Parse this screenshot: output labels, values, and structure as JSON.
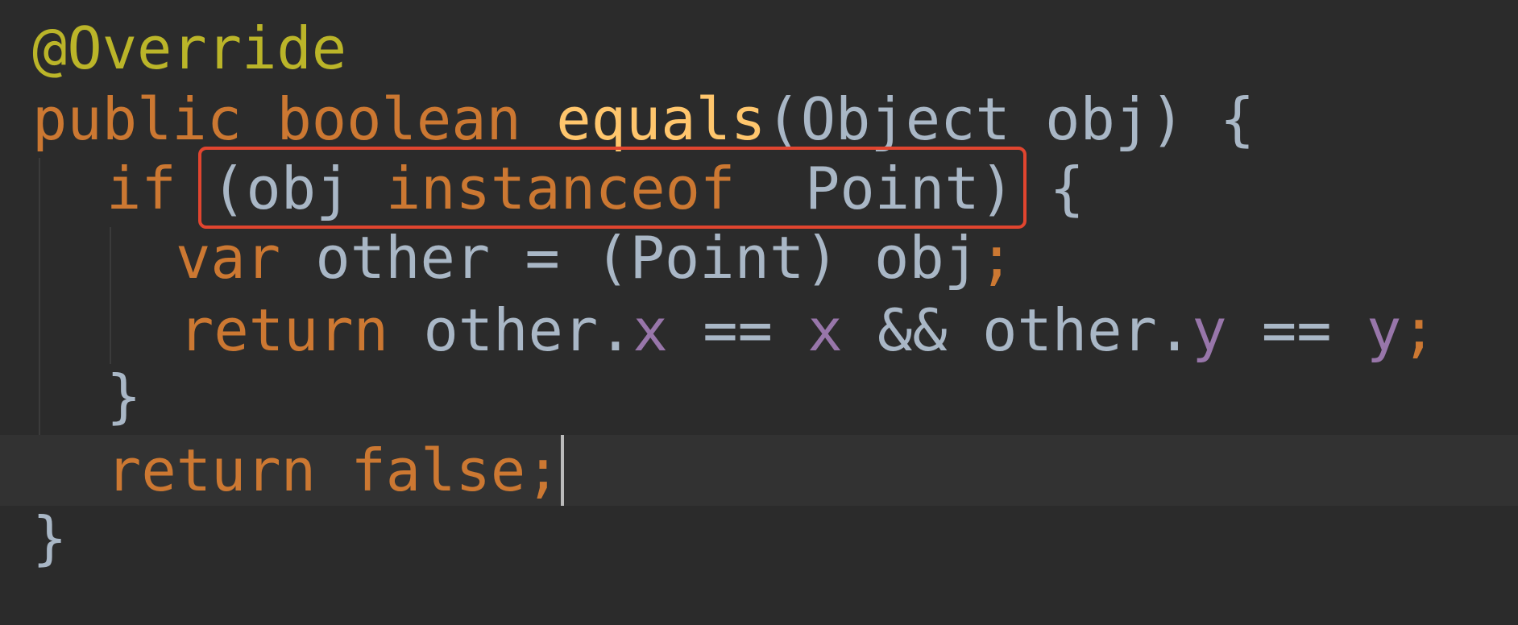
{
  "code": {
    "annotation": "@Override",
    "signature": {
      "kw_public": "public",
      "kw_boolean": "boolean",
      "method": "equals",
      "open_paren": "(",
      "param_type": "Object",
      "param_name": "obj",
      "close_paren": ")",
      "brace": "{"
    },
    "if_line": {
      "kw_if": "if",
      "condition_open": "(",
      "obj": "obj",
      "kw_instanceof": "instanceof",
      "type": "Point",
      "condition_close": ")",
      "brace": "{"
    },
    "var_line": {
      "kw_var": "var",
      "name": "other",
      "equals": "=",
      "cast": "(Point)",
      "obj": "obj",
      "semicolon": ";"
    },
    "return_line": {
      "kw_return": "return",
      "other1": "other.",
      "field_x1": "x",
      "eq1": "==",
      "field_x2": "x",
      "and": "&&",
      "other2": "other.",
      "field_y1": "y",
      "eq2": "==",
      "field_y2": "y",
      "semicolon": ";"
    },
    "close_if": "}",
    "return_false": {
      "kw_return": "return",
      "kw_false": "false",
      "semicolon": ";"
    },
    "close_method": "}"
  },
  "highlight": {
    "color": "#e1452f",
    "target": "(obj instanceof  Point)"
  },
  "colors": {
    "background": "#2b2b2b",
    "current_line": "#323232",
    "keyword": "#cc7832",
    "annotation": "#bbb529",
    "method": "#ffc66d",
    "identifier": "#a9b7c6",
    "field": "#9876aa"
  }
}
